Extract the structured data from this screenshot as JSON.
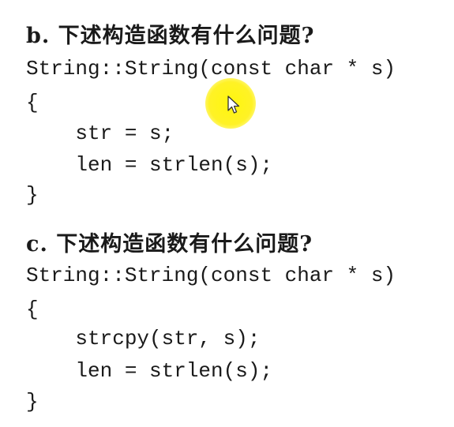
{
  "section_b": {
    "heading": "b. 下述构造函数有什么问题?",
    "code_lines": [
      "String::String(const char * s)",
      "{",
      "    str = s;",
      "    len = strlen(s);",
      "}"
    ]
  },
  "section_c": {
    "heading": "c. 下述构造函数有什么问题?",
    "code_lines": [
      "String::String(const char * s)",
      "{",
      "    strcpy(str, s);",
      "    len = strlen(s);",
      "}"
    ]
  },
  "cursor": {
    "icon": "mouse-pointer-icon",
    "highlight_color": "#fff200"
  }
}
